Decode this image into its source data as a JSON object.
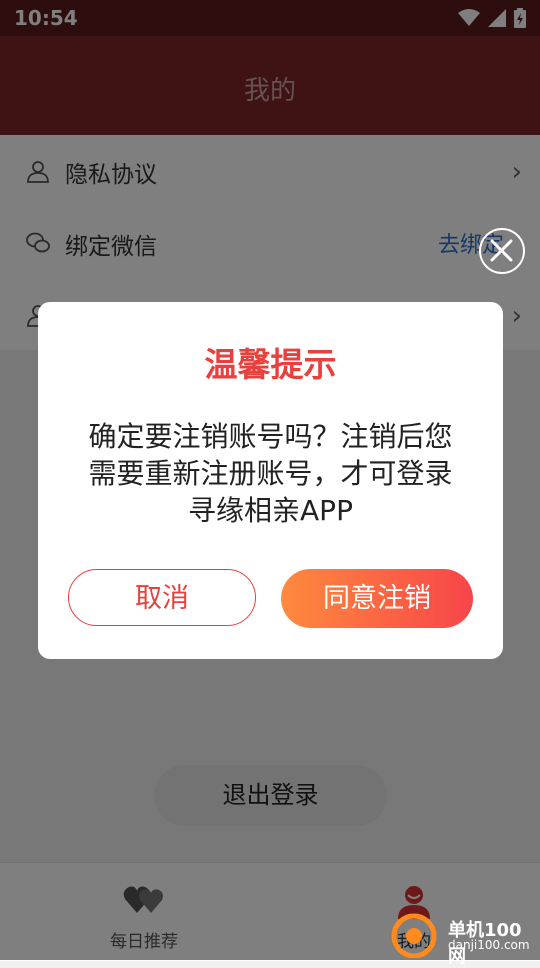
{
  "status_bar": {
    "time": "10:54"
  },
  "header": {
    "title": "我的"
  },
  "menu": {
    "items": [
      {
        "label": "隐私协议"
      },
      {
        "label": "绑定微信",
        "action": "去绑定"
      },
      {
        "label": ""
      }
    ]
  },
  "logout": {
    "label": "退出登录"
  },
  "bottom_nav": {
    "items": [
      {
        "label": "每日推荐"
      },
      {
        "label": "我的"
      }
    ]
  },
  "dialog": {
    "title": "温馨提示",
    "message": "确定要注销账号吗？注销后您需要重新注册账号，才可登录寻缘相亲APP",
    "cancel_label": "取消",
    "confirm_label": "同意注销"
  },
  "watermark": {
    "text_cn": "单机100网",
    "text_en": "danji100.com"
  },
  "colors": {
    "header": "#7f2427",
    "accent": "#e8413d",
    "gradient_start": "#ff8a3d",
    "gradient_end": "#f7454a",
    "link": "#2c6fd1"
  }
}
